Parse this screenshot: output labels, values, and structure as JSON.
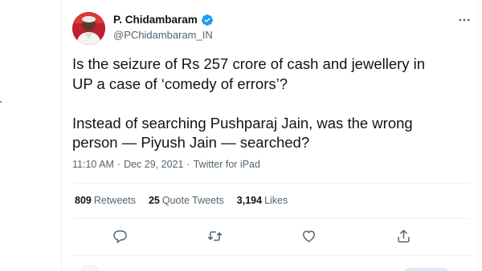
{
  "author": {
    "name": "P. Chidambaram",
    "handle": "@PChidambaram_IN",
    "verified": true,
    "avatar_icon": "profile-photo"
  },
  "tweet": {
    "text": "Is the seizure of Rs 257 crore of cash and jewellery in\nUP a case of ‘comedy of errors’?\n\nInstead of searching Pushparaj Jain, was the wrong\nperson — Piyush Jain — searched?",
    "time": "11:10 AM",
    "separator": "·",
    "date": "Dec 29, 2021",
    "source": "Twitter for iPad"
  },
  "stats": {
    "retweets_count": "809",
    "retweets_label": "Retweets",
    "quotes_count": "25",
    "quotes_label": "Quote Tweets",
    "likes_count": "3,194",
    "likes_label": "Likes"
  },
  "actions": {
    "reply_icon": "reply-icon",
    "retweet_icon": "retweet-icon",
    "like_icon": "heart-icon",
    "share_icon": "share-icon",
    "more_icon": "more-icon"
  },
  "colors": {
    "text": "#0f1419",
    "secondary": "#536471",
    "verified": "#1d9bf0",
    "border": "#eff3f4"
  }
}
